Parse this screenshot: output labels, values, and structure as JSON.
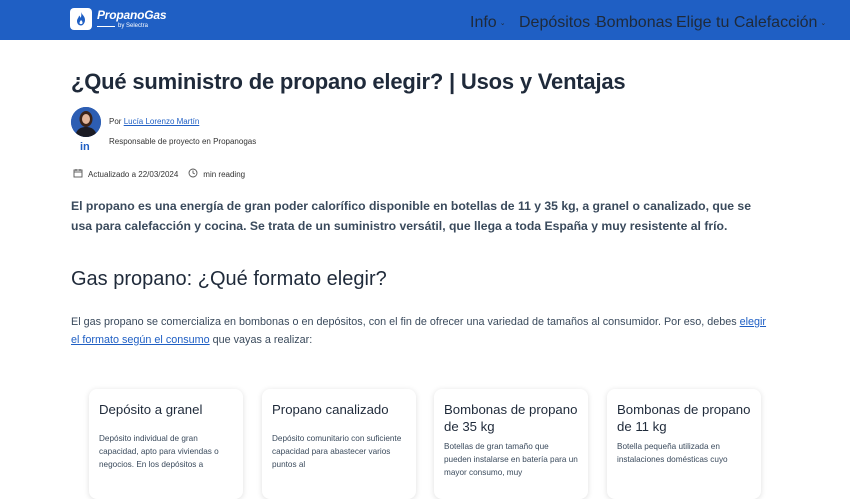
{
  "header": {
    "logo_title": "PropanoGas",
    "logo_sub": "by Selectra",
    "nav": [
      {
        "label": "Info"
      },
      {
        "label": "Depósitos"
      },
      {
        "label": "Bombonas"
      },
      {
        "label": "Elige tu Calefacción"
      }
    ]
  },
  "article": {
    "title": "¿Qué suministro de propano elegir? | Usos y Ventajas",
    "author": {
      "by_prefix": "Por",
      "name": "Lucía Lorenzo Martín",
      "role": "Responsable de proyecto en Propanogas",
      "social": "in"
    },
    "updated": "Actualizado a 22/03/2024",
    "reading": "min reading",
    "intro": "El propano es una energía de gran poder calorífico disponible en botellas de 11 y 35 kg, a granel o canalizado, que se usa para calefacción y cocina. Se trata de un suministro versátil, que llega a toda España y muy resistente al frío.",
    "section_title": "Gas propano: ¿Qué formato elegir?",
    "para_text_1": "El gas propano se comercializa en bombonas o en depósitos, con el fin de ofrecer una variedad de tamaños al consumidor. Por eso, debes ",
    "para_link": "elegir el formato según el consumo",
    "para_text_2": " que vayas a realizar:"
  },
  "cards": [
    {
      "title": "Depósito a granel",
      "desc": "Depósito individual de gran capacidad, apto para viviendas o negocios. En los depósitos a"
    },
    {
      "title": "Propano canalizado",
      "desc": "Depósito comunitario con suficiente capacidad para abastecer varios puntos al"
    },
    {
      "title": "Bombonas de propano de 35 kg",
      "desc": "Botellas de gran tamaño que pueden instalarse en batería para un mayor consumo, muy"
    },
    {
      "title": "Bombonas de propano de 11 kg",
      "desc": "Botella pequeña utilizada en instalaciones domésticas cuyo"
    }
  ],
  "colors": {
    "brand_blue": "#1f5fc4",
    "text_dark": "#1f2a3a",
    "text_body": "#3a4a5c"
  }
}
